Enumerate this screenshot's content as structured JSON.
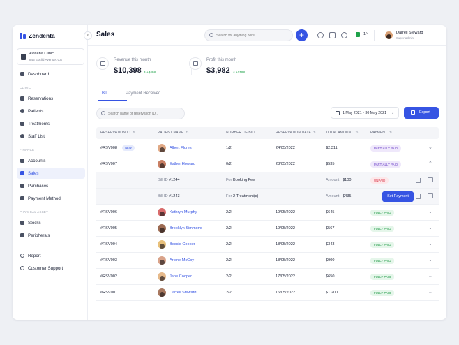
{
  "brand": {
    "name": "Zendenta"
  },
  "clinic": {
    "name": "Avicena Clinic",
    "address": "845 Euclid Avenue, CA"
  },
  "sidebar": {
    "top": {
      "label": "Dashboard"
    },
    "clinic_section": "CLINIC",
    "clinic_items": [
      "Reservations",
      "Patients",
      "Treatments",
      "Staff List"
    ],
    "finance_section": "FINANCE",
    "finance_items": [
      "Accounts",
      "Sales",
      "Purchases",
      "Payment Method"
    ],
    "asset_section": "PHYSICAL ASSET",
    "asset_items": [
      "Stocks",
      "Peripherals"
    ],
    "bottom_items": [
      "Report",
      "Customer Support"
    ],
    "active": "Sales"
  },
  "header": {
    "title": "Sales",
    "search_placeholder": "Search for anything here...",
    "flag_count": "1/4",
    "user_name": "Darrell Steward",
    "user_role": "Super admin"
  },
  "stats": {
    "revenue": {
      "label": "Revenue this month",
      "value": "$10,398",
      "delta": "+$498"
    },
    "profit": {
      "label": "Profit this month",
      "value": "$3,982",
      "delta": "+$198"
    }
  },
  "tabs": [
    "Bill",
    "Payment Received"
  ],
  "toolbar": {
    "search_placeholder": "Search name or reservation ID...",
    "date_range": "1 May 2021 - 30 May 2021",
    "export_label": "Export"
  },
  "table": {
    "columns": [
      "RESERVATION ID",
      "PATIENT NAME",
      "NUMBER OF BILL",
      "RESERVATION DATE",
      "TOTAL AMOUNT",
      "PAYMENT"
    ],
    "rows": [
      {
        "id": "#RSV008",
        "badge": "NEW",
        "patient": "Albert Flores",
        "bills": "1/2",
        "date": "24/05/2022",
        "amount": "$2.311",
        "payment": "PARTIALLY PAID"
      },
      {
        "id": "#RSV007",
        "patient": "Esther Howard",
        "bills": "0/2",
        "date": "23/05/2022",
        "amount": "$535",
        "payment": "PARTIALLY PAID"
      },
      {
        "id": "#RSV006",
        "patient": "Kathryn Murphy",
        "bills": "2/2",
        "date": "19/05/2022",
        "amount": "$645",
        "payment": "FULLY PAID"
      },
      {
        "id": "#RSV005",
        "patient": "Brooklyn Simmons",
        "bills": "2/2",
        "date": "19/05/2022",
        "amount": "$567",
        "payment": "FULLY PAID"
      },
      {
        "id": "#RSV004",
        "patient": "Bessie Cooper",
        "bills": "2/2",
        "date": "18/05/2022",
        "amount": "$343",
        "payment": "FULLY PAID"
      },
      {
        "id": "#RSV003",
        "patient": "Arlene McCoy",
        "bills": "2/2",
        "date": "18/05/2022",
        "amount": "$900",
        "payment": "FULLY PAID"
      },
      {
        "id": "#RSV002",
        "patient": "Jane Cooper",
        "bills": "2/2",
        "date": "17/05/2022",
        "amount": "$650",
        "payment": "FULLY PAID"
      },
      {
        "id": "#RSV001",
        "patient": "Darrell Steward",
        "bills": "2/2",
        "date": "16/05/2022",
        "amount": "$1.200",
        "payment": "FULLY PAID"
      }
    ],
    "sub_rows": [
      {
        "bill_label": "Bill ID",
        "bill_id": "#1244",
        "for_label": "For",
        "for_value": "Booking Fee",
        "amount_label": "Amount",
        "amount": "$100",
        "status": "UNPAID"
      },
      {
        "bill_label": "Bill ID",
        "bill_id": "#1243",
        "for_label": "For",
        "for_value": "2 Treatment(s)",
        "amount_label": "Amount",
        "amount": "$435",
        "action": "Set Payment"
      }
    ]
  },
  "colors": {
    "accent": "#3654e3",
    "success": "#1f9a45",
    "partial": "#6b3fc7",
    "danger": "#d93a4c"
  }
}
